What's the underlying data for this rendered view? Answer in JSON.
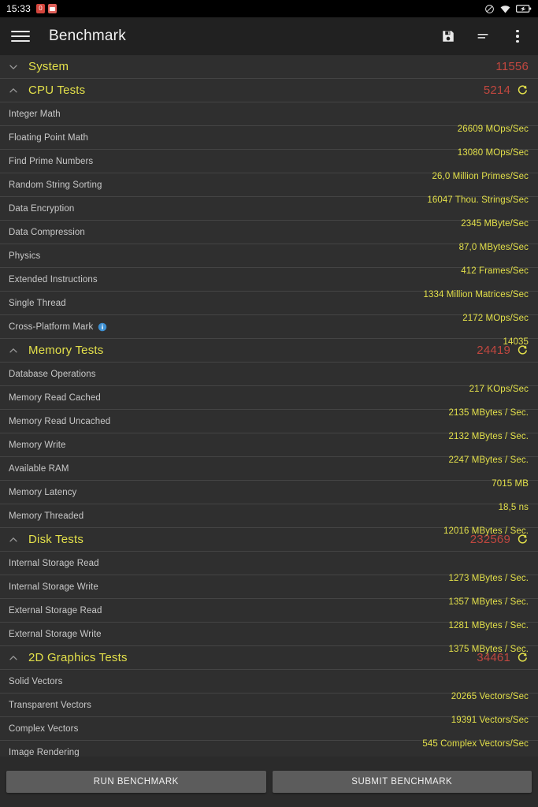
{
  "statusbar": {
    "clock": "15:33",
    "left_icons": [
      "notification-badge-icon",
      "screenshot-badge-icon"
    ],
    "right_icons": [
      "do-not-disturb-icon",
      "wifi-icon",
      "battery-charging-icon"
    ]
  },
  "appbar": {
    "menu_icon": "hamburger-menu-icon",
    "title": "Benchmark",
    "actions": [
      "save-icon",
      "sort-icon",
      "overflow-menu-icon"
    ]
  },
  "colors": {
    "accent_yellow": "#e3e04a",
    "score_red": "#c0473f",
    "label_gray": "#c9c9c9",
    "background": "#2f2f2f",
    "appbar": "#212121",
    "divider": "#444444",
    "button": "#5c5c5c",
    "info_blue": "#3d8fd1"
  },
  "sections": [
    {
      "name": "System",
      "score": "11556",
      "expanded": false,
      "chevron": "chevron-down-icon",
      "has_refresh": false,
      "tests": []
    },
    {
      "name": "CPU Tests",
      "score": "5214",
      "expanded": true,
      "chevron": "chevron-up-icon",
      "has_refresh": true,
      "tests": [
        {
          "label": "Integer Math",
          "value": "26609 MOps/Sec"
        },
        {
          "label": "Floating Point Math",
          "value": "13080 MOps/Sec"
        },
        {
          "label": "Find Prime Numbers",
          "value": "26,0 Million Primes/Sec"
        },
        {
          "label": "Random String Sorting",
          "value": "16047 Thou. Strings/Sec"
        },
        {
          "label": "Data Encryption",
          "value": "2345 MByte/Sec"
        },
        {
          "label": "Data Compression",
          "value": "87,0 MBytes/Sec"
        },
        {
          "label": "Physics",
          "value": "412 Frames/Sec"
        },
        {
          "label": "Extended Instructions",
          "value": "1334 Million Matrices/Sec"
        },
        {
          "label": "Single Thread",
          "value": "2172 MOps/Sec"
        },
        {
          "label": "Cross-Platform Mark",
          "value": "14035",
          "info": true
        }
      ]
    },
    {
      "name": "Memory Tests",
      "score": "24419",
      "expanded": true,
      "chevron": "chevron-up-icon",
      "has_refresh": true,
      "tests": [
        {
          "label": "Database Operations",
          "value": "217 KOps/Sec"
        },
        {
          "label": "Memory Read Cached",
          "value": "2135 MBytes / Sec."
        },
        {
          "label": "Memory Read Uncached",
          "value": "2132 MBytes / Sec."
        },
        {
          "label": "Memory Write",
          "value": "2247 MBytes / Sec."
        },
        {
          "label": "Available RAM",
          "value": "7015 MB"
        },
        {
          "label": "Memory Latency",
          "value": "18,5 ns"
        },
        {
          "label": "Memory Threaded",
          "value": "12016 MBytes / Sec."
        }
      ]
    },
    {
      "name": "Disk Tests",
      "score": "232569",
      "expanded": true,
      "chevron": "chevron-up-icon",
      "has_refresh": true,
      "tests": [
        {
          "label": "Internal Storage Read",
          "value": "1273 MBytes / Sec."
        },
        {
          "label": "Internal Storage Write",
          "value": "1357 MBytes / Sec."
        },
        {
          "label": "External Storage Read",
          "value": "1281 MBytes / Sec."
        },
        {
          "label": "External Storage Write",
          "value": "1375 MBytes / Sec."
        }
      ]
    },
    {
      "name": "2D Graphics Tests",
      "score": "34461",
      "expanded": true,
      "chevron": "chevron-up-icon",
      "has_refresh": true,
      "tests": [
        {
          "label": "Solid Vectors",
          "value": "20265 Vectors/Sec"
        },
        {
          "label": "Transparent Vectors",
          "value": "19391 Vectors/Sec"
        },
        {
          "label": "Complex Vectors",
          "value": "545 Complex Vectors/Sec"
        },
        {
          "label": "Image Rendering",
          "value": ""
        }
      ]
    }
  ],
  "footer": {
    "run_label": "RUN BENCHMARK",
    "submit_label": "SUBMIT BENCHMARK"
  }
}
